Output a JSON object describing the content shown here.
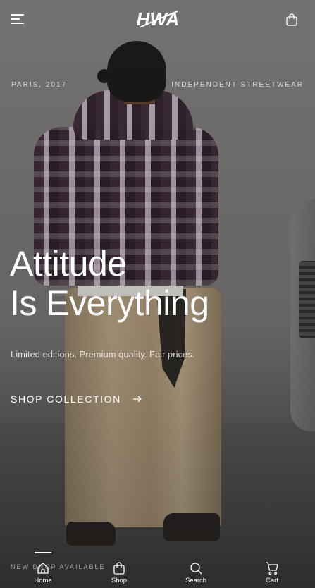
{
  "header": {
    "brand": "HWA"
  },
  "hero": {
    "meta_left": "PARIS, 2017",
    "meta_right": "INDEPENDENT STREETWEAR",
    "headline_line1": "Attitude",
    "headline_line2": "Is Everything",
    "subtitle": "Limited editions. Premium quality. Fair prices.",
    "cta_label": "SHOP COLLECTION",
    "drop_text": "NEW DROP AVAILABLE"
  },
  "icons": {
    "menu": "menu-icon",
    "cart_top": "bag-icon",
    "cta_arrow": "arrow-right-icon",
    "home": "home-icon",
    "shop": "bag-icon",
    "search": "search-icon",
    "cart": "cart-icon"
  },
  "bottom_nav": {
    "items": [
      {
        "label": "Home"
      },
      {
        "label": "Shop"
      },
      {
        "label": "Search"
      },
      {
        "label": "Cart"
      }
    ]
  },
  "colors": {
    "text": "#ffffff",
    "background": "#6e6c6a"
  }
}
